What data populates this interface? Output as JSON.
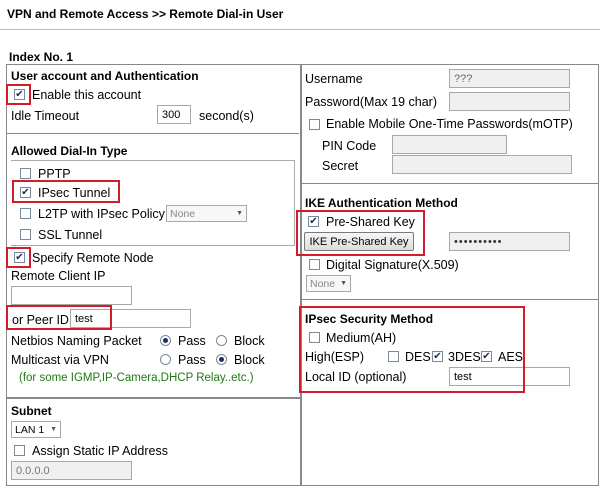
{
  "page": {
    "title": "VPN and Remote Access >> Remote Dial-in User",
    "index": "Index No. 1"
  },
  "left": {
    "account_section": "User account and Authentication",
    "enable_account": {
      "label": "Enable this account",
      "checked": true
    },
    "idle_timeout": {
      "label": "Idle Timeout",
      "value": "300",
      "unit": "second(s)"
    },
    "dialin_section": "Allowed Dial-In Type",
    "pptp": {
      "label": "PPTP",
      "checked": false
    },
    "ipsec": {
      "label": "IPsec Tunnel",
      "checked": true
    },
    "l2tp": {
      "label": "L2TP with IPsec Policy",
      "checked": false,
      "policy": "None"
    },
    "ssl": {
      "label": "SSL Tunnel",
      "checked": false
    },
    "specify_node": {
      "label": "Specify Remote Node",
      "checked": true
    },
    "remote_client_ip": {
      "label": "Remote Client IP",
      "value": ""
    },
    "peer_id": {
      "label": "or Peer ID",
      "value": "test"
    },
    "netbios": {
      "label": "Netbios Naming Packet",
      "pass": "Pass",
      "block": "Block",
      "selected": "Pass"
    },
    "multicast": {
      "label": "Multicast via VPN",
      "pass": "Pass",
      "block": "Block",
      "selected": "Block"
    },
    "multicast_note": "(for some IGMP,IP-Camera,DHCP Relay..etc.)",
    "subnet_section": "Subnet",
    "subnet_select": "LAN 1",
    "assign_static": {
      "label": "Assign Static IP Address",
      "checked": false
    },
    "static_ip": {
      "placeholder": "0.0.0.0"
    }
  },
  "right": {
    "username": {
      "label": "Username",
      "value": "???"
    },
    "password": {
      "label": "Password(Max 19 char)",
      "value": ""
    },
    "motp": {
      "label": "Enable Mobile One-Time Passwords(mOTP)",
      "checked": false
    },
    "pin_code": {
      "label": "PIN Code",
      "value": ""
    },
    "secret": {
      "label": "Secret",
      "value": ""
    },
    "ike_section": "IKE Authentication Method",
    "psk": {
      "label": "Pre-Shared Key",
      "checked": true
    },
    "ike_psk_button": "IKE Pre-Shared Key",
    "psk_value": "••••••••••",
    "digital_sig": {
      "label": "Digital Signature(X.509)",
      "checked": false
    },
    "cert_select": "None",
    "ipsec_section": "IPsec Security Method",
    "medium_ah": {
      "label": "Medium(AH)",
      "checked": false
    },
    "high_esp": "High(ESP)",
    "des": {
      "label": "DES",
      "checked": false
    },
    "tdes": {
      "label": "3DES",
      "checked": true
    },
    "aes": {
      "label": "AES",
      "checked": true
    },
    "local_id": {
      "label": "Local ID (optional)",
      "value": "test"
    }
  },
  "colors": {
    "highlight": "#d21d2a",
    "note": "#1e7a12",
    "border": "#888888"
  }
}
